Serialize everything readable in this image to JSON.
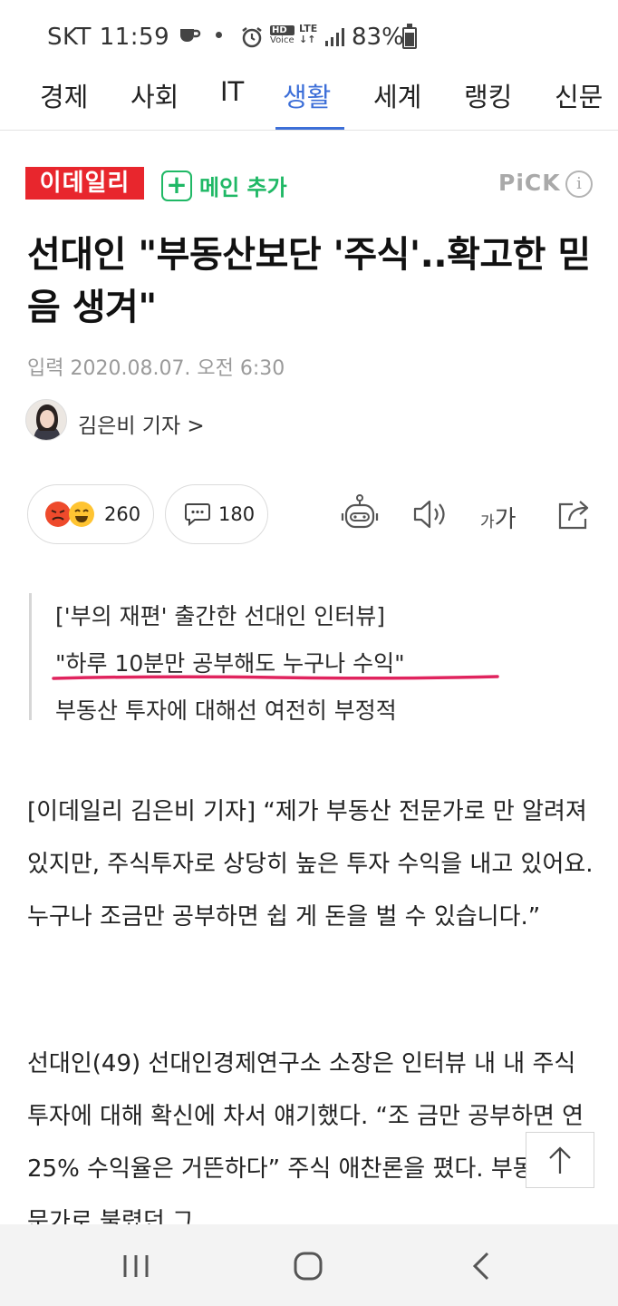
{
  "status_bar": {
    "carrier": "SKT",
    "time": "11:59",
    "network_hd": "HD",
    "network_voice": "Voice",
    "network_lte": "LTE",
    "battery_percent": "83%",
    "battery_level": 0.83
  },
  "tabs": [
    {
      "label": "경제",
      "active": false
    },
    {
      "label": "사회",
      "active": false
    },
    {
      "label": "IT",
      "active": false
    },
    {
      "label": "생활",
      "active": true
    },
    {
      "label": "세계",
      "active": false
    },
    {
      "label": "랭킹",
      "active": false
    },
    {
      "label": "신문",
      "active": false
    }
  ],
  "article_header": {
    "press_name": "이데일리",
    "add_main_label": "메인 추가",
    "pick_label": "PiCK",
    "info_glyph": "i"
  },
  "article": {
    "headline": "선대인 \"부동산보단 '주식'..확고한 믿음 생겨\"",
    "datetime": "입력 2020.08.07. 오전 6:30",
    "reporter": "김은비 기자 >",
    "reaction_count": "260",
    "comment_count": "180",
    "font_size_label_small": "가",
    "font_size_label_large": "가",
    "summary": [
      "['부의 재편' 출간한 선대인 인터뷰]",
      "\"하루 10분만 공부해도 누구나 수익\"",
      "부동산 투자에 대해선 여전히 부정적"
    ],
    "paragraphs": [
      "[이데일리 김은비 기자] “제가 부동산 전문가로 만 알려져 있지만, 주식투자로 상당히 높은 투자 수익을 내고 있어요. 누구나 조금만 공부하면 쉽 게 돈을 벌 수 있습니다.”",
      "선대인(49) 선대인경제연구소 소장은 인터뷰 내 내 주식 투자에 대해 확신에 차서 얘기했다. “조 금만 공부하면 연 25% 수익율은 거뜬하다” 주식 애찬론을 폈다. 부동산 전문가로 불렸던 그"
    ]
  },
  "colors": {
    "accent_blue": "#3d6fd8",
    "press_red": "#e8262d",
    "add_green": "#1fb865",
    "highlight_pink": "#e0245e"
  }
}
